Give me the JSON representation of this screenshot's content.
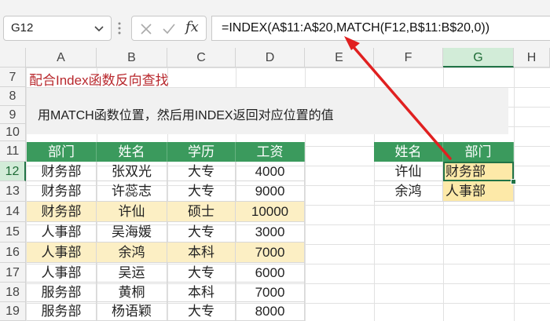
{
  "name_box": {
    "value": "G12"
  },
  "formula_bar": {
    "fx_label": "fx",
    "formula": "=INDEX(A$11:A$20,MATCH(F12,B$11:B$20,0))"
  },
  "columns": [
    "A",
    "B",
    "C",
    "D",
    "E",
    "F",
    "G",
    "H"
  ],
  "rows": [
    "7",
    "8",
    "9",
    "10",
    "11",
    "12",
    "13",
    "14",
    "15",
    "16",
    "17",
    "18",
    "19"
  ],
  "sheet": {
    "title": "配合Index函数反向查找",
    "note": "用MATCH函数位置，然后用INDEX返回对应位置的值"
  },
  "left_table": {
    "headers": [
      "部门",
      "姓名",
      "学历",
      "工资"
    ],
    "rows": [
      [
        "财务部",
        "张双光",
        "大专",
        "4000"
      ],
      [
        "财务部",
        "许蕊志",
        "大专",
        "9000"
      ],
      [
        "财务部",
        "许仙",
        "硕士",
        "10000"
      ],
      [
        "人事部",
        "吴海媛",
        "大专",
        "3000"
      ],
      [
        "人事部",
        "余鸿",
        "本科",
        "7000"
      ],
      [
        "人事部",
        "吴运",
        "大专",
        "6000"
      ],
      [
        "服务部",
        "黄桐",
        "本科",
        "7000"
      ],
      [
        "服务部",
        "杨语颖",
        "大专",
        "8000"
      ]
    ]
  },
  "right_table": {
    "headers": [
      "姓名",
      "部门"
    ],
    "rows": [
      [
        "许仙",
        "财务部"
      ],
      [
        "余鸿",
        "人事部"
      ]
    ]
  },
  "colors": {
    "header_green": "#3b9a5d",
    "highlight": "#fcefc4",
    "result": "#fde9a8",
    "arrow": "#e02020",
    "title_red": "#b8282d"
  }
}
